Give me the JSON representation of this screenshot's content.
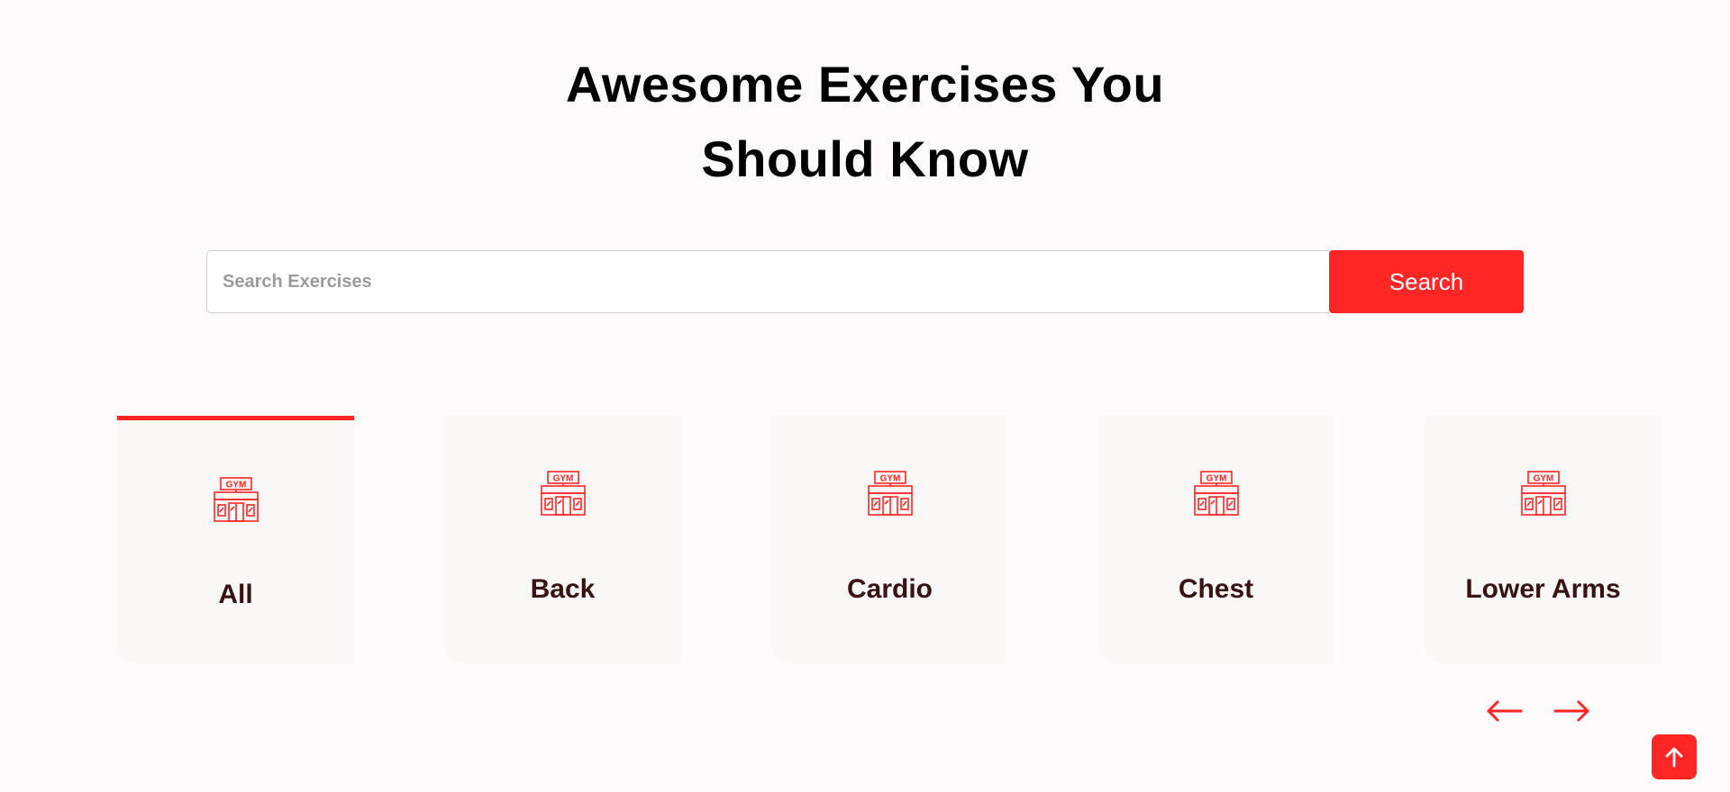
{
  "hero": {
    "title_line1": "Awesome Exercises You",
    "title_line2": "Should Know"
  },
  "search": {
    "placeholder": "Search Exercises",
    "value": "",
    "button_label": "Search"
  },
  "categories": {
    "selected": "All",
    "items": [
      {
        "label": "All",
        "icon": "gym-icon"
      },
      {
        "label": "Back",
        "icon": "gym-icon"
      },
      {
        "label": "Cardio",
        "icon": "gym-icon"
      },
      {
        "label": "Chest",
        "icon": "gym-icon"
      },
      {
        "label": "Lower Arms",
        "icon": "gym-icon"
      }
    ]
  },
  "carousel": {
    "prev_icon": "arrow-left-icon",
    "next_icon": "arrow-right-icon"
  },
  "scroll_top": {
    "icon": "arrow-up-icon"
  },
  "colors": {
    "accent": "#ff2625",
    "background": "#fffafb",
    "card_background": "#faf7f7",
    "card_label": "#3a1212"
  }
}
